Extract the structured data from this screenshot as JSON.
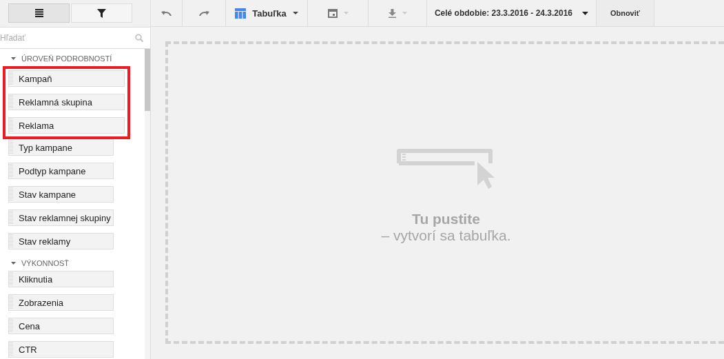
{
  "side_tabs": [
    {
      "kind": "list",
      "selected": true
    },
    {
      "kind": "filter",
      "selected": false
    }
  ],
  "search": {
    "placeholder": "Hľadať"
  },
  "sections": [
    {
      "title": "ÚROVEŇ PODROBNOSTÍ",
      "expanded": true,
      "items": [
        {
          "label": "Kampaň",
          "highlighted": true
        },
        {
          "label": "Reklamná skupina",
          "highlighted": true
        },
        {
          "label": "Reklama",
          "highlighted": true
        },
        {
          "label": "Typ kampane",
          "highlighted": false
        },
        {
          "label": "Podtyp kampane",
          "highlighted": false
        },
        {
          "label": "Stav kampane",
          "highlighted": false
        },
        {
          "label": "Stav reklamnej skupiny",
          "highlighted": false
        },
        {
          "label": "Stav reklamy",
          "highlighted": false
        }
      ]
    },
    {
      "title": "VÝKONNOSŤ",
      "expanded": true,
      "items": [
        {
          "label": "Kliknutia",
          "highlighted": false
        },
        {
          "label": "Zobrazenia",
          "highlighted": false
        },
        {
          "label": "Cena",
          "highlighted": false
        },
        {
          "label": "CTR",
          "highlighted": false
        }
      ]
    }
  ],
  "toolbar": {
    "view": "Tabuľka",
    "date_range": "Celé obdobie: 23.3.2016 - 24.3.2016",
    "refresh": "Obnoviť"
  },
  "drop_zone": {
    "title": "Tu pustite",
    "subtitle": "– vytvorí sa tabuľka."
  }
}
